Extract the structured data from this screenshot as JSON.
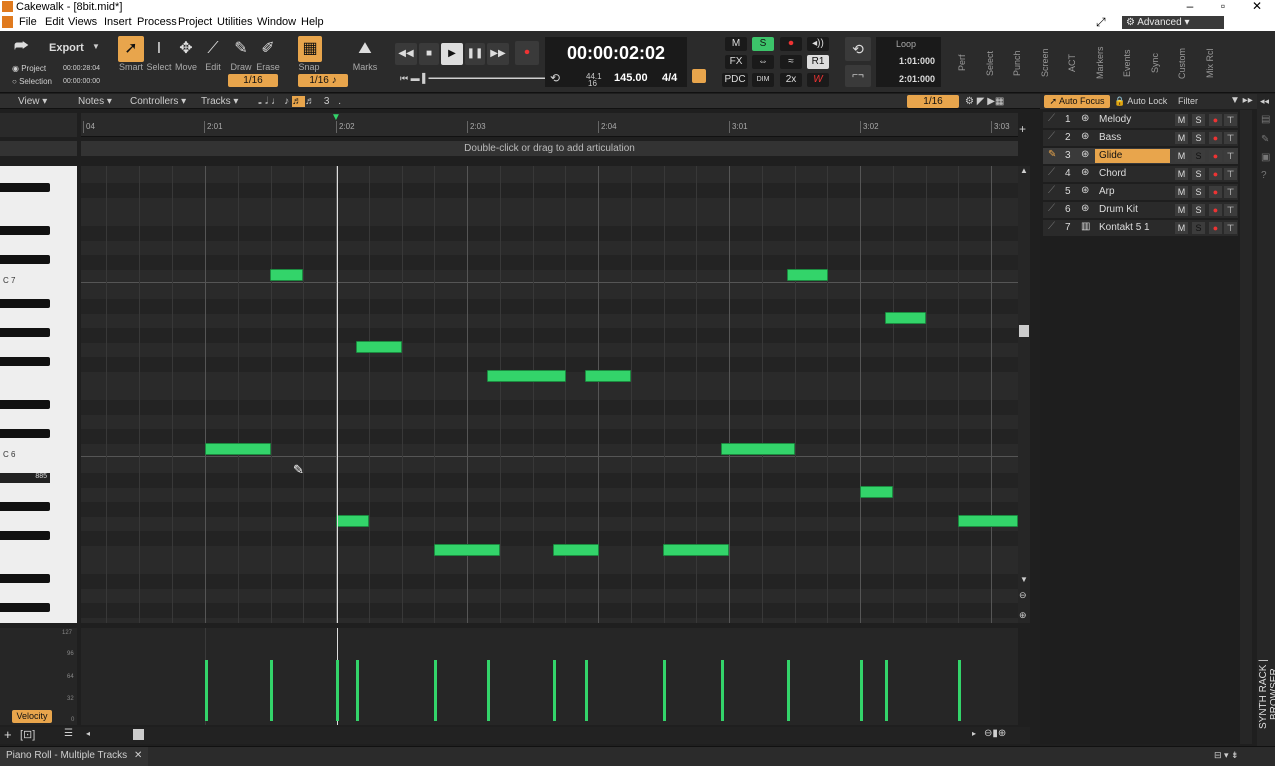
{
  "window": {
    "title": "Cakewalk - [8bit.mid*]",
    "min": "–",
    "restore": "▫",
    "close": "✕",
    "workspace": "Advanced"
  },
  "menu": [
    "File",
    "Edit",
    "Views",
    "Insert",
    "Process",
    "Project",
    "Utilities",
    "Window",
    "Help"
  ],
  "control": {
    "export": "Export",
    "project_label": "Project",
    "project_time": "00:00:28:04",
    "selection_label": "Selection",
    "selection_time": "00:00:00:00",
    "tools": [
      "Smart",
      "Select",
      "Move",
      "Edit",
      "Draw",
      "Erase"
    ],
    "tool_snap": "1/16",
    "snap_label": "Snap",
    "snap_value": "1/16",
    "marks_label": "Marks",
    "time": "00:00:02:02",
    "sample_rate": "44.1",
    "bit_depth": "16",
    "tempo": "145.00",
    "meter": "4/4",
    "mix_buttons": [
      "M",
      "S",
      "FX",
      "R",
      "PDC",
      "2x"
    ],
    "loop_label": "Loop",
    "loop_start": "1:01:000",
    "loop_end": "2:01:000",
    "vtabs": [
      "Perf",
      "Select",
      "Punch",
      "Screen",
      "ACT",
      "Markers",
      "Events",
      "Sync",
      "Custom",
      "Mix Rcl"
    ]
  },
  "pr_toolbar": {
    "view": "View",
    "notes": "Notes",
    "controllers": "Controllers",
    "tracks": "Tracks",
    "snap": "1/16"
  },
  "ruler": [
    "04",
    "2:01",
    "2:02",
    "2:03",
    "2:04",
    "3:01",
    "3:02",
    "3:03"
  ],
  "articulation_hint": "Double-click or drag to add articulation",
  "keys": {
    "c7": "C 7",
    "c6": "C 6",
    "vel_tag": "885"
  },
  "velocity": {
    "label": "Velocity",
    "scale": [
      "127",
      "96",
      "64",
      "32",
      "0"
    ]
  },
  "track_panel": {
    "auto_focus": "Auto Focus",
    "auto_lock": "Auto Lock",
    "filter": "Filter",
    "tracks": [
      {
        "num": "1",
        "name": "Melody",
        "selected": false,
        "solo": false
      },
      {
        "num": "2",
        "name": "Bass",
        "selected": false,
        "solo": false
      },
      {
        "num": "3",
        "name": "Glide",
        "selected": true,
        "solo": true
      },
      {
        "num": "4",
        "name": "Chord",
        "selected": false,
        "solo": false
      },
      {
        "num": "5",
        "name": "Arp",
        "selected": false,
        "solo": false
      },
      {
        "num": "6",
        "name": "Drum Kit",
        "selected": false,
        "solo": false
      },
      {
        "num": "7",
        "name": "Kontakt 5 1",
        "selected": false,
        "solo": true
      }
    ]
  },
  "side_tabs": "SYNTH RACK | BROWSER",
  "bottom_tab": "Piano Roll - Multiple Tracks"
}
